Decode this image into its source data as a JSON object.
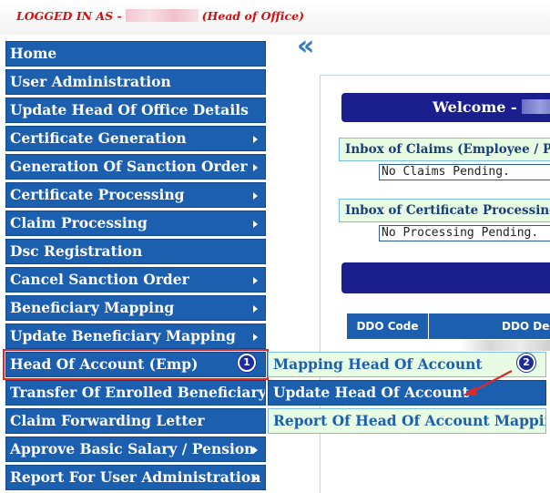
{
  "header": {
    "logged_prefix": "LOGGED IN AS -",
    "role": "(Head of Office)"
  },
  "collapse_glyph": "«",
  "menu": {
    "items": [
      {
        "label": "Home",
        "has_submenu": false
      },
      {
        "label": "User Administration",
        "has_submenu": false
      },
      {
        "label": "Update Head Of Office Details",
        "has_submenu": false
      },
      {
        "label": "Certificate Generation",
        "has_submenu": true
      },
      {
        "label": "Generation Of Sanction Order",
        "has_submenu": true
      },
      {
        "label": "Certificate Processing",
        "has_submenu": true
      },
      {
        "label": "Claim Processing",
        "has_submenu": true
      },
      {
        "label": "Dsc Registration",
        "has_submenu": false
      },
      {
        "label": "Cancel Sanction Order",
        "has_submenu": true
      },
      {
        "label": "Beneficiary Mapping",
        "has_submenu": true
      },
      {
        "label": "Update Beneficiary Mapping",
        "has_submenu": true
      },
      {
        "label": "Head Of Account (Emp)",
        "has_submenu": true
      },
      {
        "label": "Transfer Of Enrolled Beneficiary",
        "has_submenu": false
      },
      {
        "label": "Claim Forwarding Letter",
        "has_submenu": false
      },
      {
        "label": "Approve Basic Salary / Pension",
        "has_submenu": true
      },
      {
        "label": "Report For User Administration",
        "has_submenu": true
      }
    ]
  },
  "badges": {
    "one": "1",
    "two": "2"
  },
  "submenu": {
    "items": [
      {
        "label": "Mapping Head Of Account"
      },
      {
        "label": "Update Head Of Account"
      },
      {
        "label": "Report Of Head Of Account Mapping"
      }
    ]
  },
  "main": {
    "welcome_prefix": "Welcome -",
    "inbox_claims_title": "Inbox of Claims (Employee / Pe",
    "inbox_claims_body": "No Claims Pending.",
    "inbox_cert_title": "Inbox of Certificate Processing",
    "inbox_cert_body": "No Processing Pending.",
    "table_headers": [
      "DDO Code",
      "DDO De"
    ]
  },
  "colors": {
    "menu_bg": "#1c5fae",
    "header_text": "#d01010",
    "welcome_bg": "#1b1f8e",
    "submenu_light_bg": "#e8fbe3",
    "highlight_red": "#e0282a"
  }
}
